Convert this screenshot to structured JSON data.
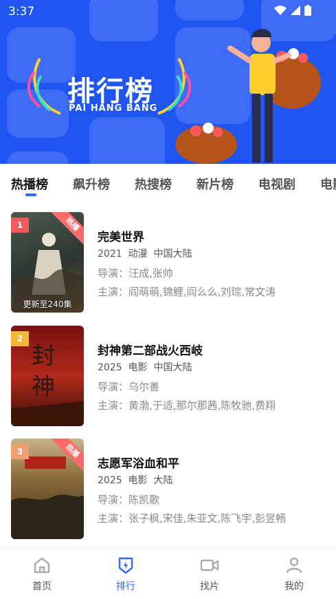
{
  "status_bar": {
    "time": "3:37"
  },
  "banner": {
    "title_cn": "排行榜",
    "title_en": "PAI HANG BANG"
  },
  "tabs": [
    {
      "label": "热播榜",
      "active": true
    },
    {
      "label": "飙升榜",
      "active": false
    },
    {
      "label": "热搜榜",
      "active": false
    },
    {
      "label": "新片榜",
      "active": false
    },
    {
      "label": "电视剧",
      "active": false
    },
    {
      "label": "电影",
      "active": false
    }
  ],
  "items": [
    {
      "rank": "1",
      "rank_color": "#f05a5a",
      "hot_badge": "热播",
      "caption": "更新至240集",
      "title": "完美世界",
      "year": "2021",
      "genre": "动漫",
      "region": "中国大陆",
      "director": "导演：汪成,张帅",
      "cast": "主演：阎萌萌,锦鲤,阎么么,刘琮,常文涛"
    },
    {
      "rank": "2",
      "rank_color": "#f2b83a",
      "hot_badge": "",
      "caption": "",
      "title": "封神第二部战火西岐",
      "year": "2025",
      "genre": "电影",
      "region": "中国大陆",
      "director": "导演：乌尔善",
      "cast": "主演：黄渤,于适,那尔那茜,陈牧驰,费翔"
    },
    {
      "rank": "3",
      "rank_color": "#f0a070",
      "hot_badge": "热播",
      "caption": "",
      "title": "志愿军浴血和平",
      "year": "2025",
      "genre": "电影",
      "region": "大陆",
      "director": "导演：陈凯歌",
      "cast": "主演：张子枫,宋佳,朱亚文,陈飞宇,彭昱畅"
    }
  ],
  "bottom_nav": [
    {
      "label": "首页",
      "icon": "home-icon",
      "active": false
    },
    {
      "label": "排行",
      "icon": "ranking-icon",
      "active": true
    },
    {
      "label": "找片",
      "icon": "video-camera-icon",
      "active": false
    },
    {
      "label": "我的",
      "icon": "user-icon",
      "active": false
    }
  ],
  "colors": {
    "accent": "#2f6bf2",
    "banner_bg": "#1f55f0",
    "hot_ribbon": "#ff6a6a"
  }
}
